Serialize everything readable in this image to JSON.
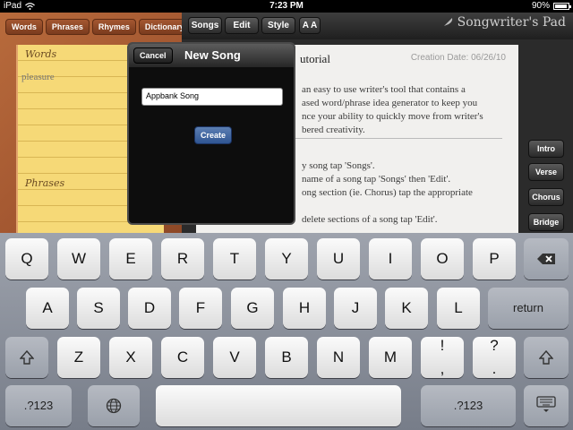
{
  "status_bar": {
    "device": "iPad",
    "time": "7:23 PM",
    "battery": "90%",
    "battery_level": 0.9
  },
  "left_panel": {
    "tabs": [
      "Words",
      "Phrases",
      "Rhymes",
      "Dictionary"
    ],
    "words_card_title": "Words",
    "words_card_text": "pleasure",
    "phrases_card_title": "Phrases"
  },
  "toolbar": {
    "songs": "Songs",
    "edit": "Edit",
    "style": "Style",
    "font_size": "A A"
  },
  "brand": {
    "name": "Songwriter's Pad"
  },
  "document": {
    "title": "utorial",
    "creation_date": "Creation Date: 06/26/10",
    "lines_top": [
      "an easy to use writer's tool that contains a",
      "ased word/phrase idea generator to keep you",
      "nce your ability to quickly move from writer's",
      "bered creativity."
    ],
    "lines_bottom": [
      "y song tap 'Songs'.",
      "name of a song tap 'Songs' then 'Edit'.",
      "ong section (ie. Chorus) tap the appropriate",
      "",
      "delete sections of a song tap 'Edit'."
    ]
  },
  "section_buttons": [
    "Intro",
    "Verse",
    "Chorus",
    "Bridge"
  ],
  "popover": {
    "cancel": "Cancel",
    "title": "New Song",
    "input_value": "Appbank Song",
    "create": "Create"
  },
  "keyboard": {
    "row1": [
      "Q",
      "W",
      "E",
      "R",
      "T",
      "Y",
      "U",
      "I",
      "O",
      "P"
    ],
    "row2": [
      "A",
      "S",
      "D",
      "F",
      "G",
      "H",
      "J",
      "K",
      "L"
    ],
    "row3": [
      "Z",
      "X",
      "C",
      "V",
      "B",
      "N",
      "M"
    ],
    "return_label": "return",
    "numbers_label": ".?123",
    "exclaim_top": "!",
    "exclaim_bottom": ",",
    "question_top": "?",
    "question_bottom": "."
  }
}
